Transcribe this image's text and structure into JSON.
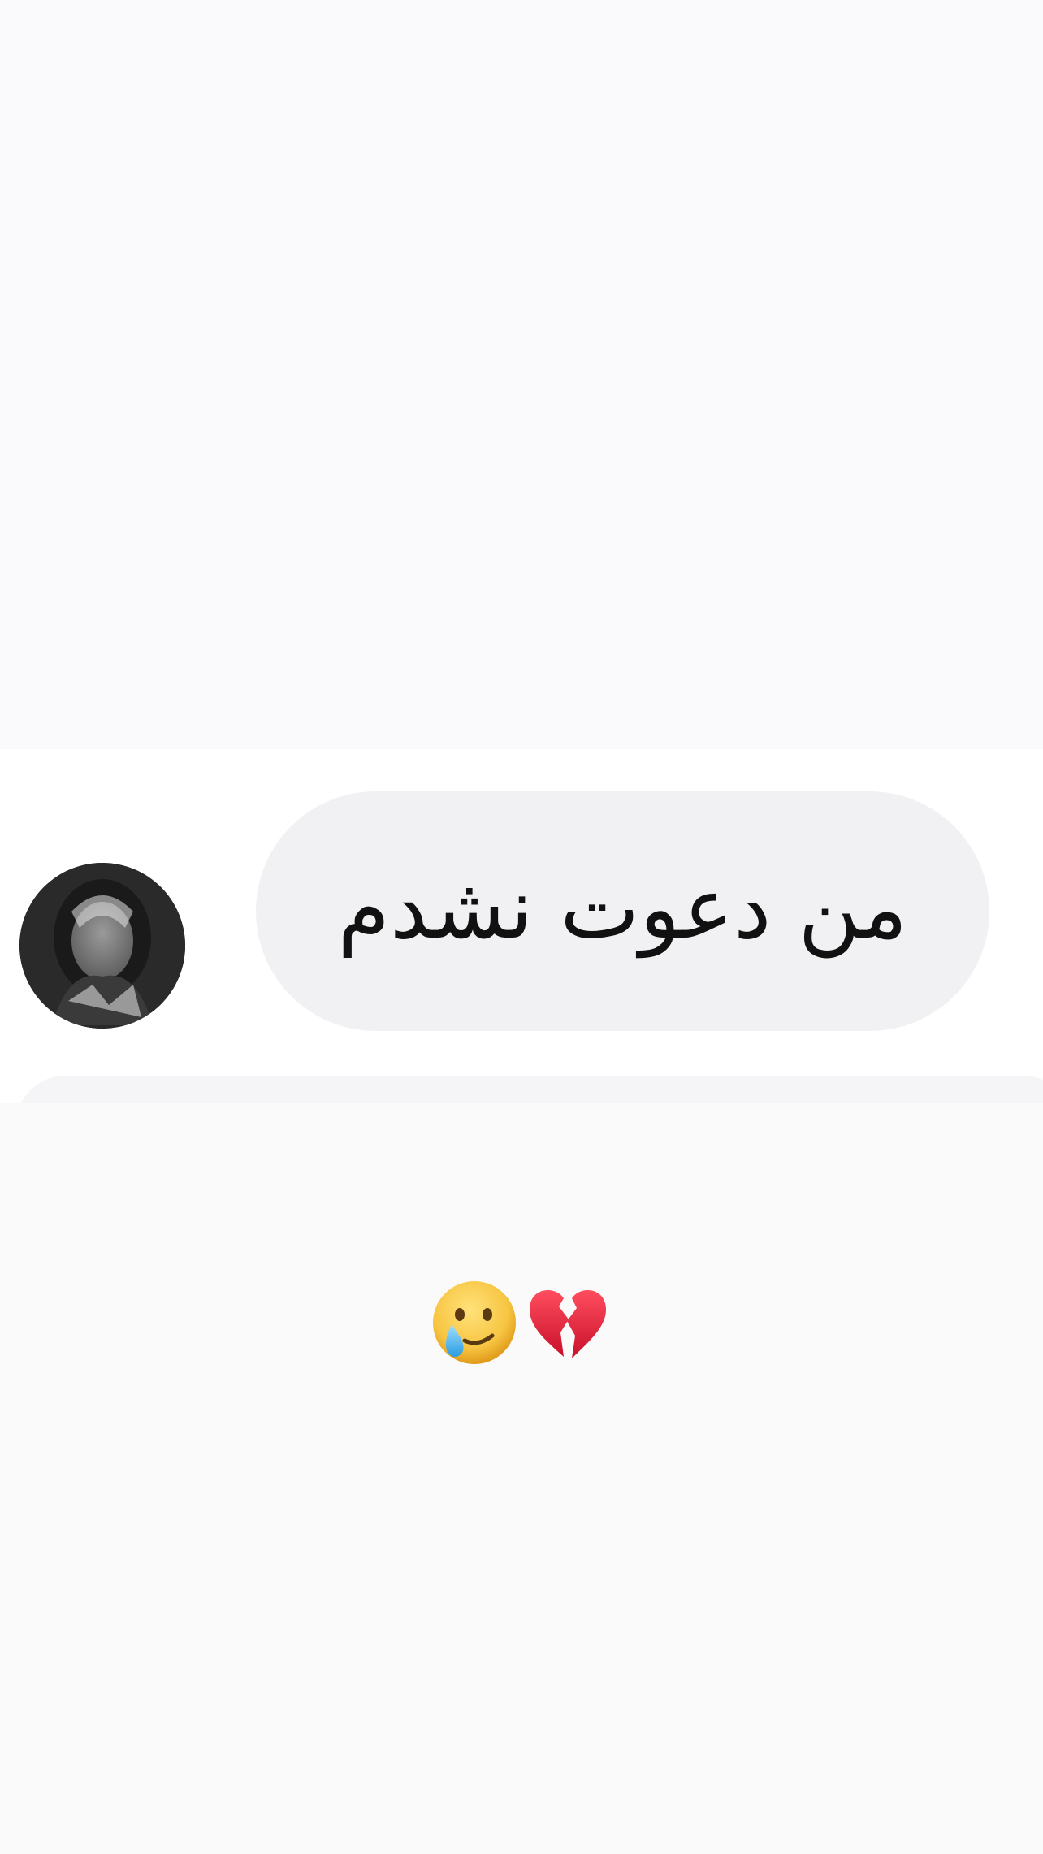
{
  "message": {
    "text": "من دعوت نشدم",
    "avatar_icon": "user-avatar-photo"
  },
  "reaction": {
    "icons": [
      "face-holding-back-tears-icon",
      "broken-heart-icon"
    ]
  },
  "colors": {
    "background": "#fafafc",
    "bubble": "#f1f1f4",
    "text": "#111111",
    "heart": "#e0182d",
    "face": "#f7c542"
  }
}
